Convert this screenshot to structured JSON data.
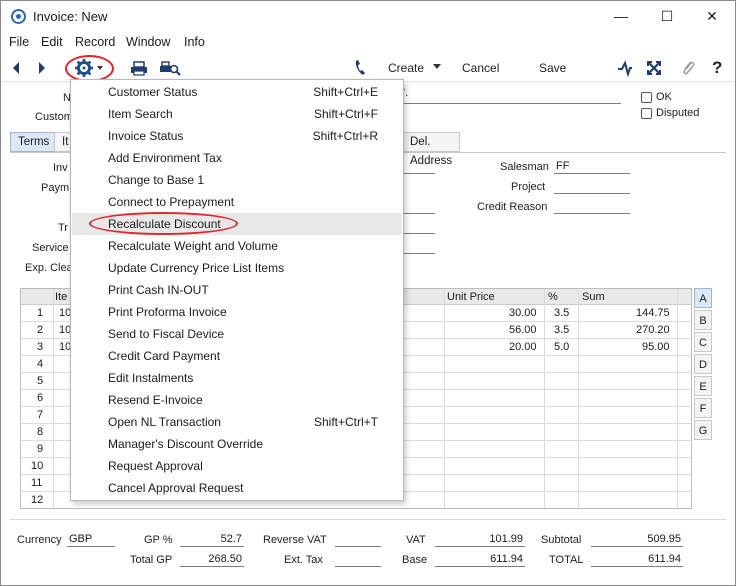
{
  "window": {
    "title": "Invoice: New",
    "minimize_glyph": "—",
    "maximize_glyph": "☐",
    "close_glyph": "✕"
  },
  "menubar": [
    "File",
    "Edit",
    "Record",
    "Window",
    "Info"
  ],
  "toolbar": {
    "create": "Create",
    "cancel": "Cancel",
    "save": "Save",
    "help": "?"
  },
  "header": {
    "no_label_partial": "N",
    "customer_label_partial": "Custom",
    "tail_text": "'.",
    "ok_label": "OK",
    "disputed_label": "Disputed"
  },
  "tabs": [
    {
      "label": "Terms",
      "active": true
    },
    {
      "label": "It",
      "active": false
    },
    {
      "label": "Del. Address",
      "active": false
    }
  ],
  "terms": {
    "left_labels": [
      "Inv",
      "Paym",
      "Tr",
      "Service",
      "Exp. Clea"
    ],
    "salesman_label": "Salesman",
    "salesman_value": "FF",
    "project_label": "Project",
    "project_value": "",
    "credit_reason_label": "Credit Reason",
    "credit_reason_value": ""
  },
  "grid": {
    "columns": {
      "item": "Ite",
      "unit_price": "Unit Price",
      "pct": "%",
      "sum": "Sum"
    },
    "rows": [
      {
        "n": "1",
        "item": "10",
        "unit_price": "30.00",
        "pct": "3.5",
        "sum": "144.75"
      },
      {
        "n": "2",
        "item": "10",
        "unit_price": "56.00",
        "pct": "3.5",
        "sum": "270.20"
      },
      {
        "n": "3",
        "item": "10",
        "unit_price": "20.00",
        "pct": "5.0",
        "sum": "95.00"
      },
      {
        "n": "4",
        "item": "",
        "unit_price": "",
        "pct": "",
        "sum": ""
      },
      {
        "n": "5",
        "item": "",
        "unit_price": "",
        "pct": "",
        "sum": ""
      },
      {
        "n": "6",
        "item": "",
        "unit_price": "",
        "pct": "",
        "sum": ""
      },
      {
        "n": "7",
        "item": "",
        "unit_price": "",
        "pct": "",
        "sum": ""
      },
      {
        "n": "8",
        "item": "",
        "unit_price": "",
        "pct": "",
        "sum": ""
      },
      {
        "n": "9",
        "item": "",
        "unit_price": "",
        "pct": "",
        "sum": ""
      },
      {
        "n": "10",
        "item": "",
        "unit_price": "",
        "pct": "",
        "sum": ""
      },
      {
        "n": "11",
        "item": "",
        "unit_price": "",
        "pct": "",
        "sum": ""
      },
      {
        "n": "12",
        "item": "",
        "unit_price": "",
        "pct": "",
        "sum": ""
      }
    ],
    "side_tabs": [
      "A",
      "B",
      "C",
      "D",
      "E",
      "F",
      "G"
    ]
  },
  "footer": {
    "currency_label": "Currency",
    "currency_value": "GBP",
    "gp_pct_label": "GP %",
    "gp_pct_value": "52.7",
    "total_gp_label": "Total GP",
    "total_gp_value": "268.50",
    "reverse_vat_label": "Reverse VAT",
    "reverse_vat_value": "",
    "ext_tax_label": "Ext. Tax",
    "ext_tax_value": "",
    "vat_label": "VAT",
    "vat_value": "101.99",
    "base_label": "Base",
    "base_value": "611.94",
    "subtotal_label": "Subtotal",
    "subtotal_value": "509.95",
    "total_label": "TOTAL",
    "total_value": "611.94"
  },
  "operations_menu": [
    {
      "label": "Customer Status",
      "shortcut": "Shift+Ctrl+E"
    },
    {
      "label": "Item Search",
      "shortcut": "Shift+Ctrl+F"
    },
    {
      "label": "Invoice Status",
      "shortcut": "Shift+Ctrl+R"
    },
    {
      "label": "Add Environment Tax",
      "shortcut": ""
    },
    {
      "label": "Change to Base 1",
      "shortcut": ""
    },
    {
      "label": "Connect to Prepayment",
      "shortcut": ""
    },
    {
      "label": "Recalculate Discount",
      "shortcut": "",
      "highlighted": true
    },
    {
      "label": "Recalculate Weight and Volume",
      "shortcut": ""
    },
    {
      "label": "Update Currency Price List Items",
      "shortcut": ""
    },
    {
      "label": "Print Cash IN-OUT",
      "shortcut": ""
    },
    {
      "label": "Print Proforma Invoice",
      "shortcut": ""
    },
    {
      "label": "Send to Fiscal Device",
      "shortcut": ""
    },
    {
      "label": "Credit Card Payment",
      "shortcut": ""
    },
    {
      "label": "Edit Instalments",
      "shortcut": ""
    },
    {
      "label": "Resend E-Invoice",
      "shortcut": ""
    },
    {
      "label": "Open NL Transaction",
      "shortcut": "Shift+Ctrl+T"
    },
    {
      "label": "Manager's Discount Override",
      "shortcut": ""
    },
    {
      "label": "Request Approval",
      "shortcut": ""
    },
    {
      "label": "Cancel Approval Request",
      "shortcut": ""
    }
  ],
  "colors": {
    "highlight_ring": "#e2262b",
    "active_tab": "#dbe8f6",
    "accent_blue": "#2a68b5"
  }
}
